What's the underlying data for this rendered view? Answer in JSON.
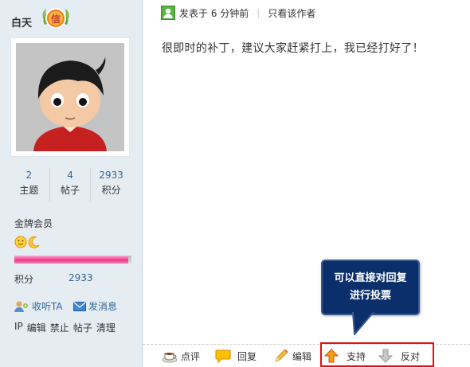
{
  "author": {
    "username": "白天",
    "badge_icon": "honor-medal-icon"
  },
  "stats": [
    {
      "value": "2",
      "label": "主题"
    },
    {
      "value": "4",
      "label": "帖子"
    },
    {
      "value": "2933",
      "label": "积分"
    }
  ],
  "rank": {
    "title": "金牌会员",
    "icons": [
      "sun-icon",
      "moon-icon"
    ]
  },
  "points": {
    "label": "积分",
    "value": "2933"
  },
  "actions": {
    "follow": "收听TA",
    "message": "发消息"
  },
  "mod_links": [
    "IP",
    "编辑",
    "禁止",
    "帖子",
    "清理"
  ],
  "post": {
    "posted_label": "发表于 6 分钟前",
    "author_only_label": "只看该作者",
    "content": "很即时的补丁，建议大家赶紧打上，我已经打好了！"
  },
  "tooltip": {
    "line1": "可以直接对回复",
    "line2": "进行投票"
  },
  "footer": {
    "rate": "点评",
    "reply": "回复",
    "edit": "编辑",
    "support": "支持",
    "oppose": "反对"
  },
  "colors": {
    "sidebar_bg": "#e5edf2",
    "link": "#336699",
    "tooltip_bg": "#0a2f6b",
    "highlight_border": "#e01010"
  }
}
